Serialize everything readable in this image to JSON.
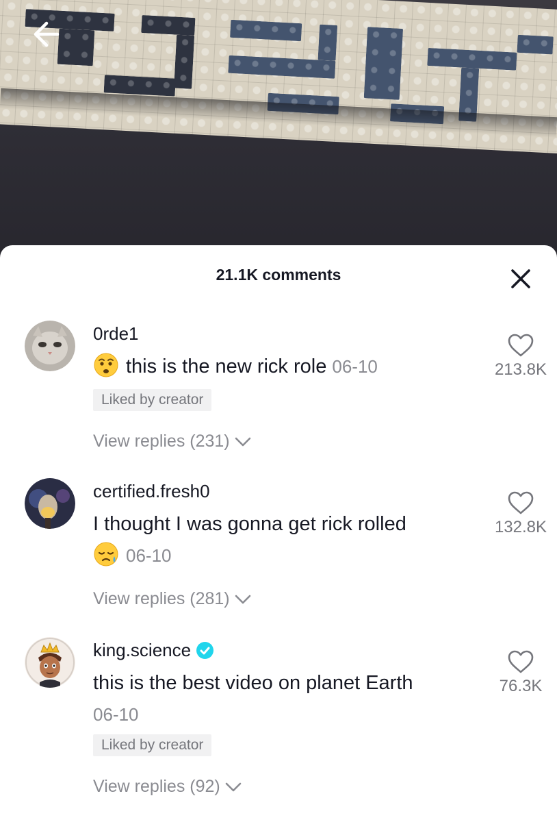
{
  "header": {
    "back_icon": "arrow-left-icon",
    "comments_count_label": "21.1K comments",
    "close_icon": "close-icon"
  },
  "comments": [
    {
      "username": "0rde1",
      "emoji": "worried-face-emoji",
      "text": "this is the new rick role",
      "date": "06-10",
      "liked_by_creator": "Liked by creator",
      "likes": "213.8K",
      "replies": "View replies (231)"
    },
    {
      "username": "certified.fresh0",
      "text": "I thought I was gonna get rick rolled",
      "emoji": "sad-sweat-face-emoji",
      "date": "06-10",
      "likes": "132.8K",
      "replies": "View replies (281)"
    },
    {
      "username": "king.science",
      "verified": true,
      "text": "this is the best video on planet Earth",
      "date": "06-10",
      "liked_by_creator": "Liked by creator",
      "likes": "76.3K",
      "replies": "View replies (92)"
    }
  ],
  "colors": {
    "text_primary": "#161823",
    "text_secondary": "#8a8b91",
    "verified_badge": "#20d5ec",
    "chip_background": "#f1f1f2"
  }
}
